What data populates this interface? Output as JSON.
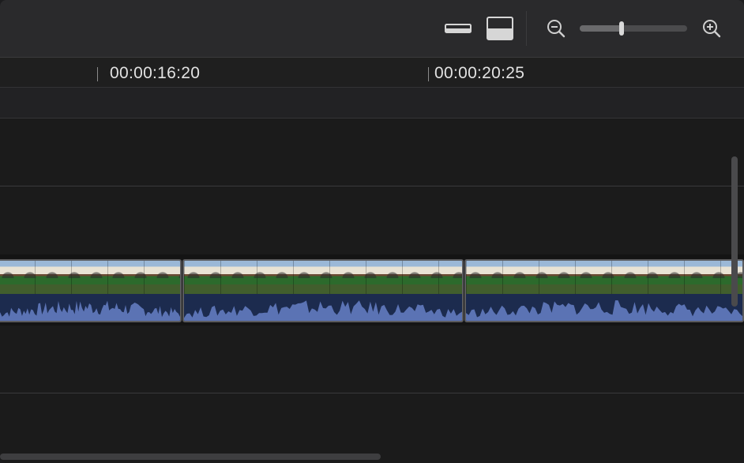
{
  "toolbar": {
    "buttons": [
      {
        "name": "clip-appearance-small-icon"
      },
      {
        "name": "clip-appearance-large-icon"
      },
      {
        "name": "zoom-out-icon"
      },
      {
        "name": "zoom-in-icon"
      }
    ],
    "zoom_level": 0.39
  },
  "ruler": {
    "timecodes": [
      "00:00:16:20",
      "00:00:20:25"
    ]
  },
  "clips": [
    {
      "name": "clip-1"
    },
    {
      "name": "clip-2"
    },
    {
      "name": "clip-3"
    }
  ],
  "colors": {
    "toolbar_bg": "#2a2a2c",
    "timeline_bg": "#1b1b1b",
    "waveform": "#5b73b4",
    "waveform_bg": "#1c2b4e"
  }
}
